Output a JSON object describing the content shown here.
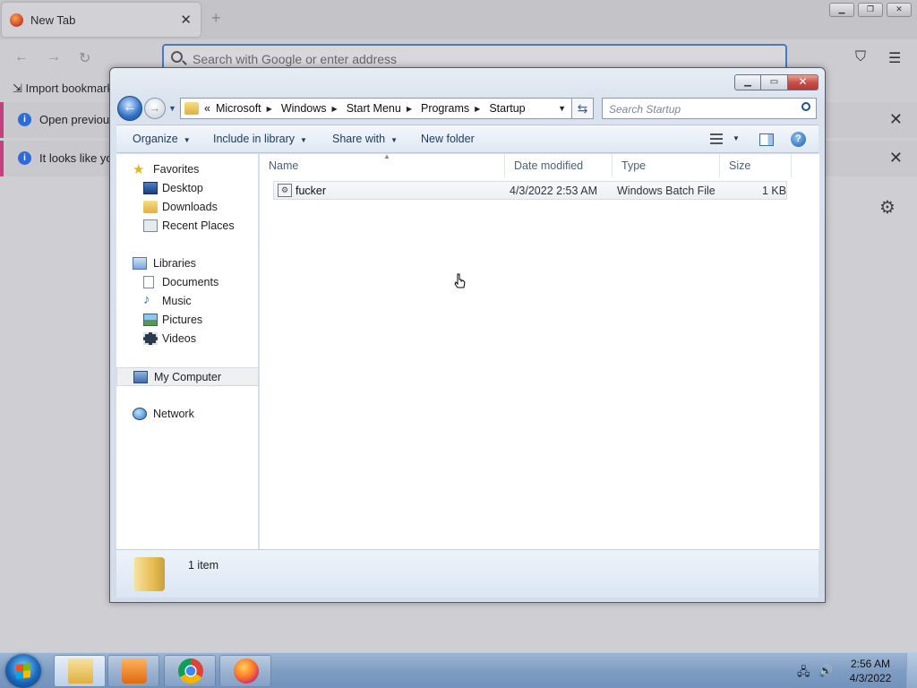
{
  "browser": {
    "tab_title": "New Tab",
    "tab_close": "✕",
    "new_tab": "+",
    "url_placeholder": "Search with Google or enter address",
    "bookmark_import": "Import bookmark",
    "infobar1_text": "Open previous",
    "infobar2_text": "It looks like you",
    "close_glyph": "✕",
    "info_glyph": "i"
  },
  "explorer": {
    "caption_buttons": {
      "minimize": "▁",
      "maximize": "▭",
      "close": "✕"
    },
    "breadcrumb": {
      "chevron": "«",
      "items": [
        "Microsoft",
        "Windows",
        "Start Menu",
        "Programs",
        "Startup"
      ]
    },
    "search_placeholder": "Search Startup",
    "toolbar": {
      "organize": "Organize",
      "include_in_library": "Include in library",
      "share_with": "Share with",
      "new_folder": "New folder",
      "help": "?"
    },
    "nav": {
      "favorites": "Favorites",
      "desktop": "Desktop",
      "downloads": "Downloads",
      "recent_places": "Recent Places",
      "libraries": "Libraries",
      "documents": "Documents",
      "music": "Music",
      "pictures": "Pictures",
      "videos": "Videos",
      "my_computer": "My Computer",
      "network": "Network"
    },
    "columns": {
      "name": "Name",
      "date_modified": "Date modified",
      "type": "Type",
      "size": "Size"
    },
    "files": [
      {
        "name": "fucker",
        "date_modified": "4/3/2022 2:53 AM",
        "type": "Windows Batch File",
        "size": "1 KB"
      }
    ],
    "status": {
      "count": "1 item"
    }
  },
  "taskbar": {
    "time": "2:56 AM",
    "date": "4/3/2022"
  }
}
